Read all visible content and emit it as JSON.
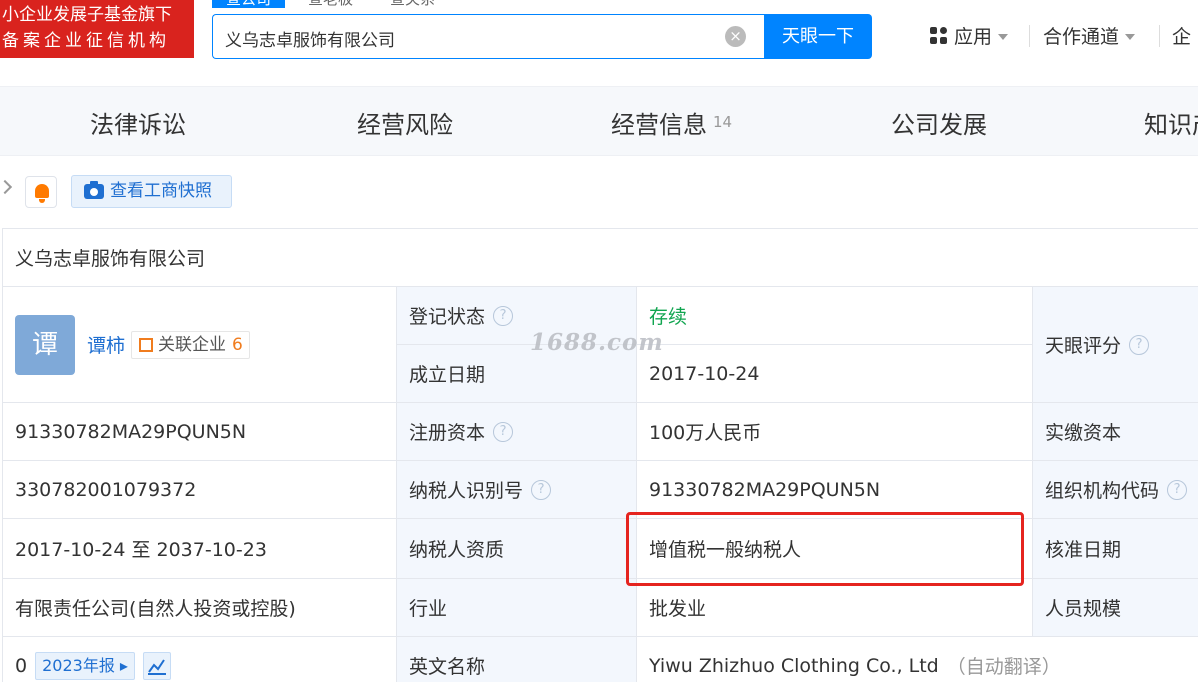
{
  "header": {
    "promo_line1": "小企业发展子基金旗下",
    "promo_line2": "备案企业征信机构",
    "search_tabs": [
      "查公司",
      "查老板",
      "查关系"
    ],
    "search_value": "义乌志卓服饰有限公司",
    "search_button": "天眼一下",
    "nav": [
      "应用",
      "合作通道",
      "企"
    ]
  },
  "section_tabs": [
    {
      "label": "法律诉讼",
      "count": ""
    },
    {
      "label": "经营风险",
      "count": ""
    },
    {
      "label": "经营信息",
      "count": "14"
    },
    {
      "label": "公司发展",
      "count": ""
    },
    {
      "label": "知识产"
    }
  ],
  "toolbar": {
    "snapshot_label": "查看工商快照"
  },
  "company": {
    "name": "义乌志卓服饰有限公司",
    "legal_rep_avatar": "谭",
    "legal_rep": "谭柿",
    "related_label": "关联企业",
    "related_count": "6",
    "credit_code": "91330782MA29PQUN5N",
    "reg_number": "330782001079372",
    "business_term": "2017-10-24 至 2037-10-23",
    "company_type": "有限责任公司(自然人投资或控股)",
    "annual_report_prefix": "0",
    "annual_report": "2023年报"
  },
  "fields": {
    "status_label": "登记状态",
    "status_value": "存续",
    "founded_label": "成立日期",
    "founded_value": "2017-10-24",
    "capital_label": "注册资本",
    "capital_value": "100万人民币",
    "taxid_label": "纳税人识别号",
    "taxid_value": "91330782MA29PQUN5N",
    "taxtype_label": "纳税人资质",
    "taxtype_value": "增值税一般纳税人",
    "industry_label": "行业",
    "industry_value": "批发业",
    "english_label": "英文名称",
    "english_value": "Yiwu Zhizhuo Clothing Co., Ltd",
    "english_note": "（自动翻译）"
  },
  "right_col": {
    "score_label": "天眼评分",
    "paidin_label": "实缴资本",
    "orgcode_label": "组织机构代码",
    "approval_label": "核准日期",
    "staff_label": "人员规模"
  },
  "watermark": "1688.com",
  "colors": {
    "brand_blue": "#0084ff",
    "promo_red": "#d9231e",
    "status_green": "#11a550",
    "highlight_red": "#e5241f"
  }
}
